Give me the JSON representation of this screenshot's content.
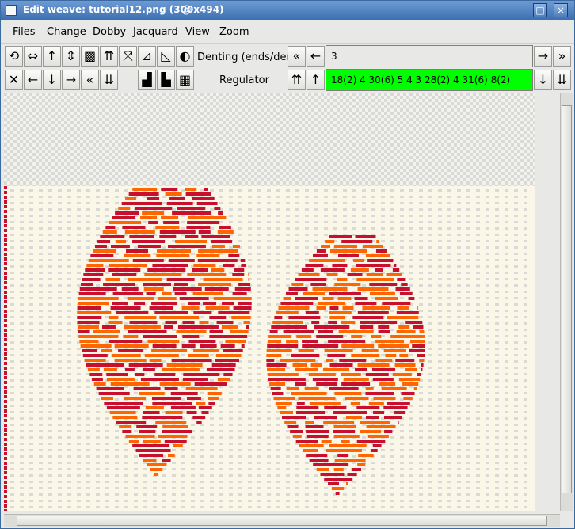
{
  "window": {
    "title": "Edit weave: tutorial12.png (300x494)"
  },
  "menu": [
    "Files",
    "Change",
    "Dobby",
    "Jacquard",
    "View",
    "Zoom"
  ],
  "toolbar": {
    "row1_icons": [
      "rotate-icon",
      "mirror-horizontal-icon",
      "arrow-up-icon",
      "flip-vertical-icon",
      "invert-icon",
      "double-up-icon",
      "cross-arrows-icon",
      "stairs-up-icon",
      "stairs-down-icon",
      "half-circle-icon"
    ],
    "row2_icons": [
      "clear-icon",
      "arrow-left-icon",
      "arrow-down-icon",
      "arrow-right-icon",
      "double-left-icon",
      "double-down-icon",
      "step-right-icon",
      "step-left-icon",
      "checker-icon"
    ],
    "denting_label": "Denting (ends/dent)",
    "denting_value": "3",
    "regulator_label": "Regulator",
    "regulator_value": "18(2) 4 30(6) 5 4 3 28(2) 4 31(6) 8(2)",
    "regulator_bg": "#00ff00"
  },
  "colors": {
    "red": "#c8102e",
    "orange": "#ff6600",
    "yellow": "#ffcc00",
    "background": "#fbf7e8",
    "grid": "#d9d9d6"
  }
}
